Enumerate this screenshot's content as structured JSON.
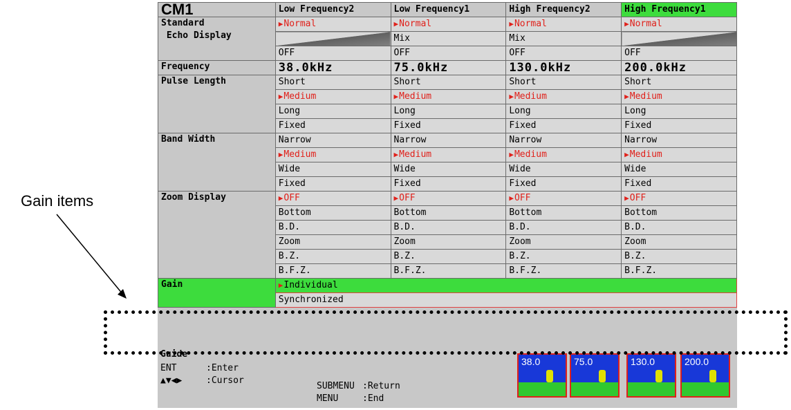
{
  "annotation": {
    "label": "Gain items"
  },
  "header": {
    "title": "CM1",
    "columns": [
      "Low Frequency2",
      "Low Frequency1",
      "High Frequency2",
      "High Frequency1"
    ]
  },
  "rows": {
    "standard_echo": {
      "label_line1": "Standard",
      "label_line2": "Echo Display",
      "normal": "Normal",
      "mix": "Mix",
      "off": "OFF"
    },
    "frequency": {
      "label": "Frequency",
      "values": [
        "38.0kHz",
        "75.0kHz",
        "130.0kHz",
        "200.0kHz"
      ]
    },
    "pulse_length": {
      "label": "Pulse Length",
      "options": [
        "Short",
        "Medium",
        "Long",
        "Fixed"
      ]
    },
    "band_width": {
      "label": "Band Width",
      "options": [
        "Narrow",
        "Medium",
        "Wide",
        "Fixed"
      ]
    },
    "zoom_display": {
      "label": "Zoom Display",
      "options": [
        "OFF",
        "Bottom",
        "B.D.",
        "Zoom",
        "B.Z.",
        "B.F.Z."
      ]
    },
    "gain": {
      "label": "Gain",
      "options": [
        "Individual",
        "Synchronized"
      ]
    }
  },
  "guide": {
    "title": "Guide",
    "ent_key": "ENT",
    "ent_action": ":Enter",
    "cursor_key": "▲▼◀▶",
    "cursor_action": ":Cursor",
    "submenu_key": "SUBMENU",
    "submenu_action": ":Return",
    "menu_key": "MENU",
    "menu_action": ":End"
  },
  "thumbnails": [
    "38.0",
    "75.0",
    "130.0",
    "200.0"
  ],
  "colors": {
    "highlight": "#3ddc3d",
    "selected": "#e0201a",
    "panel": "#c8c8c8"
  }
}
